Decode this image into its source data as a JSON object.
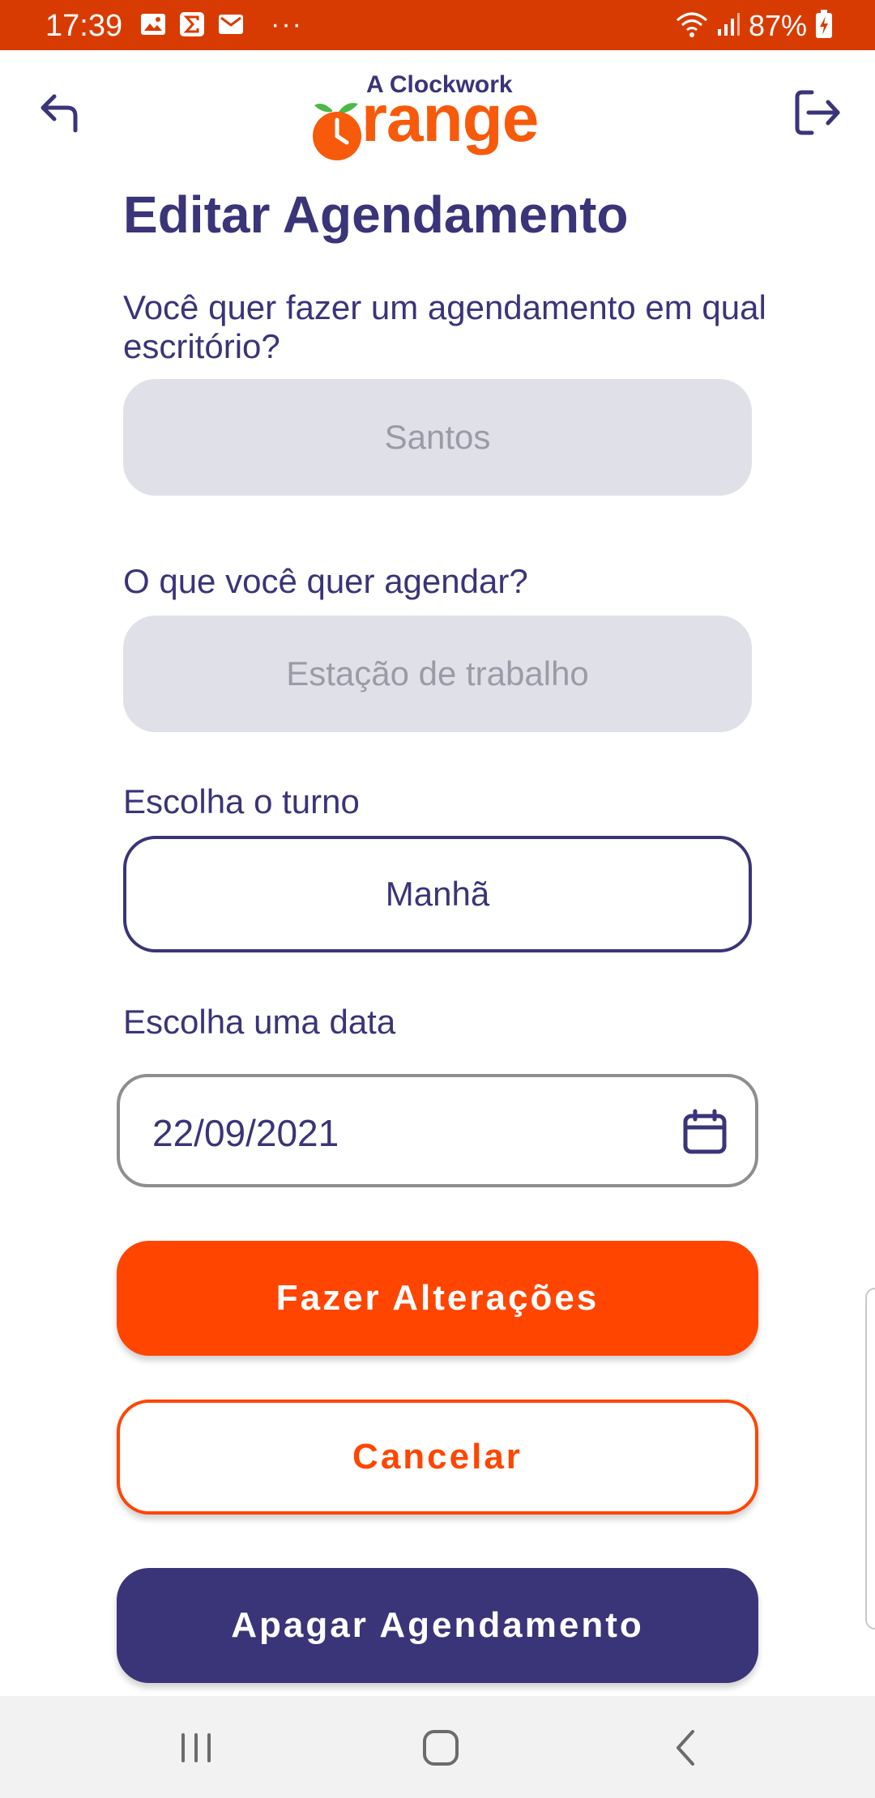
{
  "status_bar": {
    "time": "17:39",
    "notification_icons": [
      "image-icon",
      "sigma-icon",
      "mail-icon"
    ],
    "more": "···",
    "battery": "87%"
  },
  "header": {
    "logo_small": "A Clockwork",
    "logo_big": "range"
  },
  "page": {
    "title": "Editar Agendamento"
  },
  "form": {
    "office_label": "Você quer fazer um agendamento em qual escritório?",
    "office_value": "Santos",
    "type_label": "O que você quer agendar?",
    "type_value": "Estação de trabalho",
    "shift_label": "Escolha o turno",
    "shift_value": "Manhã",
    "date_label": "Escolha uma data",
    "date_value": "22/09/2021"
  },
  "buttons": {
    "save": "Fazer Alterações",
    "cancel": "Cancelar",
    "delete": "Apagar Agendamento"
  },
  "colors": {
    "primary": "#ff4500",
    "navy": "#3a3479",
    "status_bar": "#d83b01"
  }
}
